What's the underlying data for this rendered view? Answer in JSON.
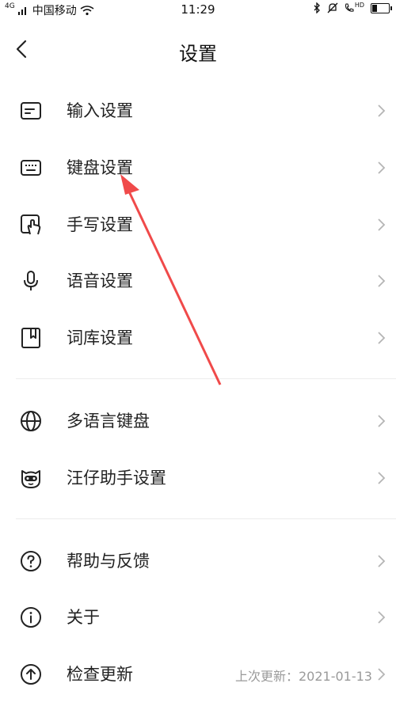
{
  "status_bar": {
    "network": "4G",
    "carrier": "中国移动",
    "time": "11:29",
    "hd_label": "HD"
  },
  "header": {
    "title": "设置"
  },
  "groups": [
    {
      "items": [
        {
          "label": "输入设置",
          "icon": "input-settings-icon"
        },
        {
          "label": "键盘设置",
          "icon": "keyboard-icon"
        },
        {
          "label": "手写设置",
          "icon": "handwriting-icon"
        },
        {
          "label": "语音设置",
          "icon": "microphone-icon"
        },
        {
          "label": "词库设置",
          "icon": "lexicon-icon"
        }
      ]
    },
    {
      "items": [
        {
          "label": "多语言键盘",
          "icon": "globe-icon"
        },
        {
          "label": "汪仔助手设置",
          "icon": "mascot-icon"
        }
      ]
    },
    {
      "items": [
        {
          "label": "帮助与反馈",
          "icon": "help-icon"
        },
        {
          "label": "关于",
          "icon": "info-icon"
        },
        {
          "label": "检查更新",
          "icon": "update-icon",
          "detail": "上次更新：2021-01-13"
        }
      ]
    }
  ],
  "annotation_color": "#f04a4a"
}
